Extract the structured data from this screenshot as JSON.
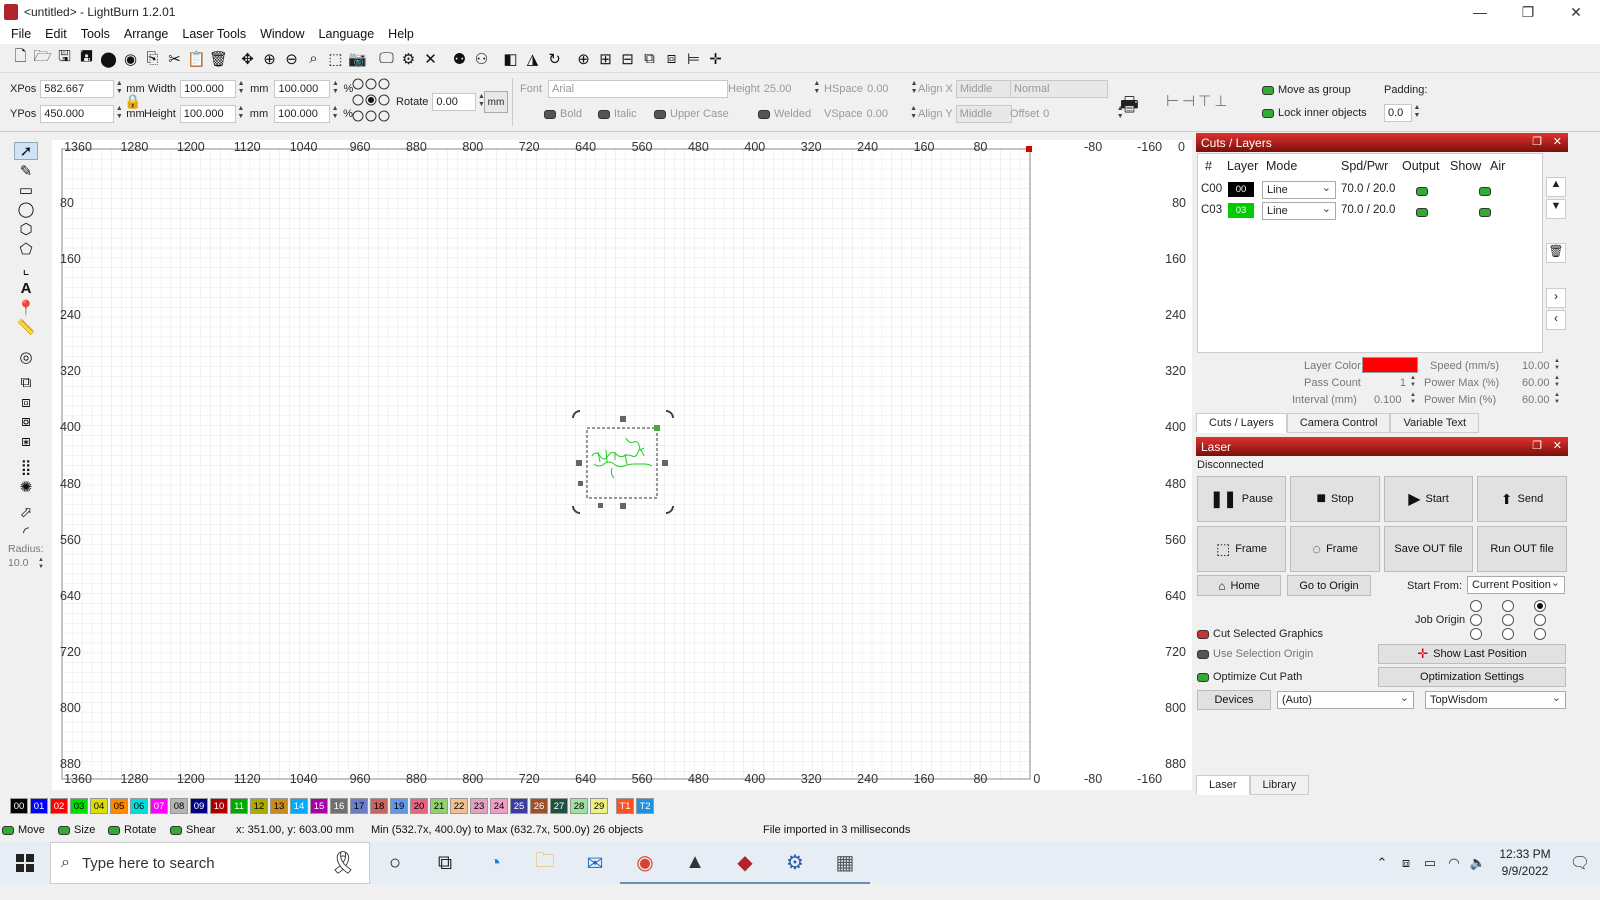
{
  "window": {
    "title": "<untitled> - LightBurn 1.2.01",
    "minimize": "—",
    "maximize": "❐",
    "close": "✕"
  },
  "menu": [
    "File",
    "Edit",
    "Tools",
    "Arrange",
    "Laser Tools",
    "Window",
    "Language",
    "Help"
  ],
  "numbers_bar": {
    "xpos_label": "XPos",
    "xpos": "582.667",
    "ypos_label": "YPos",
    "ypos": "450.000",
    "unit": "mm",
    "width_label": "Width",
    "width": "100.000",
    "height_label": "Height",
    "height": "100.000",
    "wpct": "100.000",
    "hpct": "100.000",
    "pct": "%",
    "rotate_label": "Rotate",
    "rotate": "0.00",
    "mm_button": "mm"
  },
  "text_bar": {
    "font_label": "Font",
    "font": "Arial",
    "height_label": "Height",
    "height": "25.00",
    "hspace_label": "HSpace",
    "hspace": "0.00",
    "vspace_label": "VSpace",
    "vspace": "0.00",
    "alignx_label": "Align X",
    "alignx": "Middle",
    "aligny_label": "Align Y",
    "aligny": "Middle",
    "style": "Normal",
    "offset_label": "Offset",
    "offset": "0",
    "bold": "Bold",
    "italic": "Italic",
    "upper": "Upper Case",
    "welded": "Welded"
  },
  "group_bar": {
    "move_group": "Move as group",
    "lock_inner": "Lock inner objects",
    "padding_label": "Padding:",
    "padding": "0.0"
  },
  "left_tools": {
    "radius_label": "Radius:",
    "radius": "10.0"
  },
  "ruler": {
    "top": [
      "1360",
      "1280",
      "1200",
      "1120",
      "1040",
      "960",
      "880",
      "800",
      "720",
      "640",
      "560",
      "480",
      "400",
      "320",
      "240",
      "160",
      "80",
      "",
      "-80",
      "-160"
    ],
    "top_right_zero": "0",
    "side": [
      "80",
      "160",
      "240",
      "320",
      "400",
      "480",
      "560",
      "640",
      "720",
      "800",
      "880"
    ],
    "bottom": [
      "1360",
      "1280",
      "1200",
      "1120",
      "1040",
      "960",
      "880",
      "800",
      "720",
      "640",
      "560",
      "480",
      "400",
      "320",
      "240",
      "160",
      "80",
      "0",
      "-80",
      "-160"
    ]
  },
  "cuts": {
    "title": "Cuts / Layers",
    "headers": [
      "#",
      "Layer",
      "Mode",
      "Spd/Pwr",
      "Output",
      "Show",
      "Air"
    ],
    "rows": [
      {
        "id": "C00",
        "layer": "00",
        "color": "#000000",
        "mode": "Line",
        "spdpwr": "70.0 / 20.0"
      },
      {
        "id": "C03",
        "layer": "03",
        "color": "#00cc00",
        "mode": "Line",
        "spdpwr": "70.0 / 20.0"
      }
    ],
    "layer_color_label": "Layer Color",
    "layer_color": "#ff0000",
    "pass_count_label": "Pass Count",
    "pass_count": "1",
    "interval_label": "Interval (mm)",
    "interval": "0.100",
    "speed_label": "Speed (mm/s)",
    "speed": "10.00",
    "pmax_label": "Power Max (%)",
    "pmax": "60.00",
    "pmin_label": "Power Min (%)",
    "pmin": "60.00",
    "tabs": [
      "Cuts / Layers",
      "Camera Control",
      "Variable Text"
    ]
  },
  "laser": {
    "title": "Laser",
    "status": "Disconnected",
    "pause": "Pause",
    "stop": "Stop",
    "start": "Start",
    "send": "Send",
    "frame1": "Frame",
    "frame2": "Frame",
    "save_out": "Save OUT file",
    "run_out": "Run OUT file",
    "home": "Home",
    "go_origin": "Go to Origin",
    "start_from_label": "Start From:",
    "start_from": "Current Position",
    "job_origin_label": "Job Origin",
    "cut_selected": "Cut Selected Graphics",
    "use_sel_origin": "Use Selection Origin",
    "optimize": "Optimize Cut Path",
    "show_last": "Show Last Position",
    "opt_settings": "Optimization Settings",
    "devices": "Devices",
    "port": "(Auto)",
    "device": "TopWisdom",
    "tabs": [
      "Laser",
      "Library"
    ]
  },
  "palette": [
    {
      "n": "00",
      "c": "#000000",
      "t": "#fff"
    },
    {
      "n": "01",
      "c": "#0000ff",
      "t": "#fff"
    },
    {
      "n": "02",
      "c": "#ff0000",
      "t": "#fff"
    },
    {
      "n": "03",
      "c": "#00dd00",
      "t": "#000"
    },
    {
      "n": "04",
      "c": "#dddd00",
      "t": "#000"
    },
    {
      "n": "05",
      "c": "#ff8800",
      "t": "#000"
    },
    {
      "n": "06",
      "c": "#00dddd",
      "t": "#000"
    },
    {
      "n": "07",
      "c": "#ff00ff",
      "t": "#fff"
    },
    {
      "n": "08",
      "c": "#b4b4b4",
      "t": "#000"
    },
    {
      "n": "09",
      "c": "#000080",
      "t": "#fff"
    },
    {
      "n": "10",
      "c": "#aa0000",
      "t": "#fff"
    },
    {
      "n": "11",
      "c": "#00aa00",
      "t": "#fff"
    },
    {
      "n": "12",
      "c": "#aaaa00",
      "t": "#000"
    },
    {
      "n": "13",
      "c": "#c88c1e",
      "t": "#000"
    },
    {
      "n": "14",
      "c": "#00aaff",
      "t": "#fff"
    },
    {
      "n": "15",
      "c": "#aa00aa",
      "t": "#fff"
    },
    {
      "n": "16",
      "c": "#707070",
      "t": "#fff"
    },
    {
      "n": "17",
      "c": "#6a7ec8",
      "t": "#000"
    },
    {
      "n": "18",
      "c": "#c86464",
      "t": "#000"
    },
    {
      "n": "19",
      "c": "#6496e6",
      "t": "#000"
    },
    {
      "n": "20",
      "c": "#e66480",
      "t": "#000"
    },
    {
      "n": "21",
      "c": "#90d070",
      "t": "#000"
    },
    {
      "n": "22",
      "c": "#f0c090",
      "t": "#000"
    },
    {
      "n": "23",
      "c": "#e6a0c0",
      "t": "#000"
    },
    {
      "n": "24",
      "c": "#f09ec8",
      "t": "#000"
    },
    {
      "n": "25",
      "c": "#3c3ca0",
      "t": "#fff"
    },
    {
      "n": "26",
      "c": "#a05028",
      "t": "#fff"
    },
    {
      "n": "27",
      "c": "#205040",
      "t": "#fff"
    },
    {
      "n": "28",
      "c": "#a0e0a0",
      "t": "#000"
    },
    {
      "n": "29",
      "c": "#f0f080",
      "t": "#000"
    },
    {
      "n": "T1",
      "c": "#ff5020",
      "t": "#fff"
    },
    {
      "n": "T2",
      "c": "#2090e0",
      "t": "#fff"
    }
  ],
  "status": {
    "move": "Move",
    "size": "Size",
    "rotate": "Rotate",
    "shear": "Shear",
    "coords": "x: 351.00, y: 603.00 mm",
    "range": "Min (532.7x, 400.0y) to Max (632.7x, 500.0y)  26 objects",
    "message": "File imported in 3 milliseconds"
  },
  "taskbar": {
    "search": "Type here to search",
    "time": "12:33 PM",
    "date": "9/9/2022"
  }
}
